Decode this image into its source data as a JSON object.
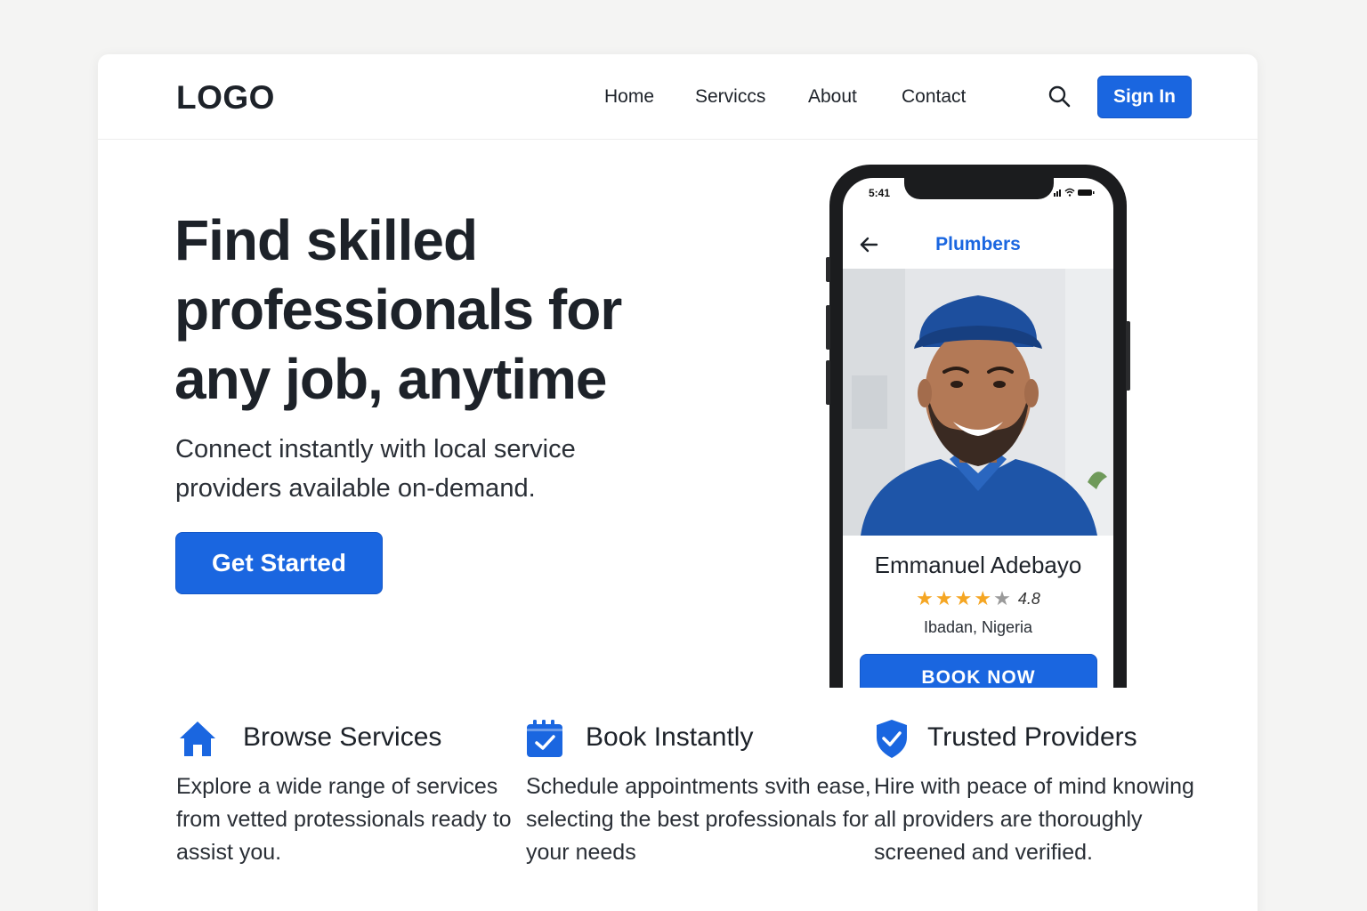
{
  "header": {
    "logo": "LOGO",
    "nav": [
      "Home",
      "Servicсs",
      "About",
      "Contact"
    ],
    "sign_in": "Sign In"
  },
  "hero": {
    "title": "Find skilled professionals for any job, anytime",
    "subtitle": "Connect instantly with local service providers available on-demand.",
    "cta": "Get Started"
  },
  "phone": {
    "status_time": "5:41",
    "screen_title": "Plumbers",
    "professional": {
      "name": "Emmanuel Adebayo",
      "rating": "4.8",
      "stars_filled": 4,
      "stars_total": 5,
      "location": "Ibadan, Nigeria"
    },
    "book_button": "BOOK NOW"
  },
  "features": [
    {
      "icon": "home-icon",
      "title": "Browse Services",
      "description": "Explore a wide range of services from vetted protessionals ready to assist you."
    },
    {
      "icon": "calendar-check-icon",
      "title": "Book Instantly",
      "description": "Schedule appointments svith ease, selecting the best professionals for your needs"
    },
    {
      "icon": "shield-check-icon",
      "title": "Trusted Providers",
      "description": "Hire with peace of mind knowing all providers are thoroughly screened and verified."
    }
  ],
  "colors": {
    "accent": "#1a66e0",
    "text": "#1d2229",
    "star": "#f5a623",
    "star_empty": "#9a9a9a"
  }
}
